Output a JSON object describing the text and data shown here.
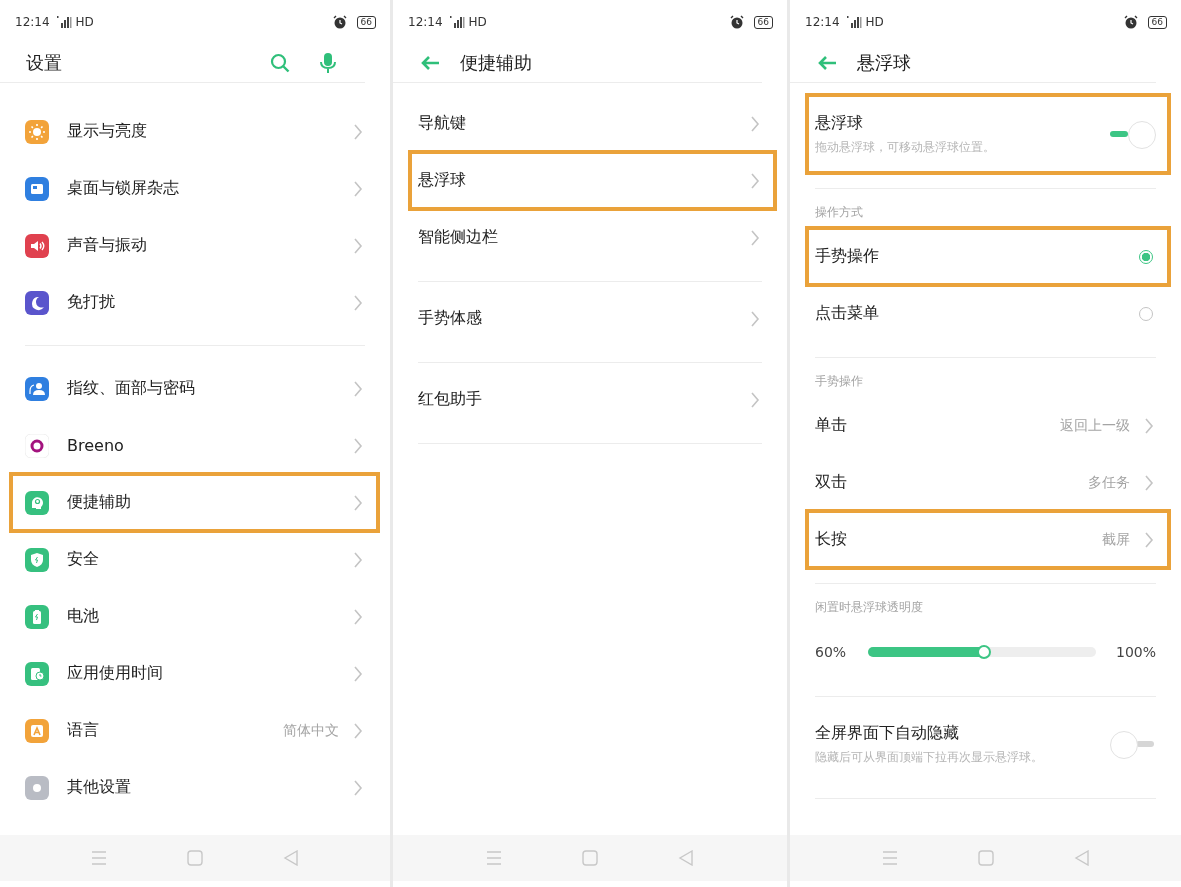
{
  "screens": [
    {
      "status_bar": {
        "time": "12:14",
        "network": "HD",
        "battery": "66"
      },
      "header": {
        "kind": "main",
        "title": "设置"
      },
      "sections": [
        {
          "items": [
            {
              "kind": "link",
              "label": "显示与亮度",
              "color": "#f2a33a",
              "highlighted": false
            },
            {
              "kind": "link",
              "label": "桌面与锁屏杂志",
              "color": "#2f7fe0",
              "highlighted": false
            },
            {
              "kind": "link",
              "label": "声音与振动",
              "color": "#e0414f",
              "highlighted": false
            },
            {
              "kind": "link",
              "label": "免打扰",
              "color": "#5a55cc",
              "highlighted": false
            }
          ]
        },
        {
          "items": [
            {
              "kind": "link",
              "label": "指纹、面部与密码",
              "color": "#2f7fe0",
              "highlighted": false
            },
            {
              "kind": "link",
              "label": "Breeno",
              "color": "#a3137e",
              "highlighted": false
            },
            {
              "kind": "link",
              "label": "便捷辅助",
              "color": "#36c07f",
              "highlighted": true
            },
            {
              "kind": "link",
              "label": "安全",
              "color": "#36c07f",
              "highlighted": false
            },
            {
              "kind": "link",
              "label": "电池",
              "color": "#36c07f",
              "highlighted": false
            },
            {
              "kind": "link",
              "label": "应用使用时间",
              "color": "#36c07f",
              "highlighted": false
            },
            {
              "kind": "link",
              "label": "语言",
              "value": "简体中文",
              "color": "#f2a33a",
              "highlighted": false
            },
            {
              "kind": "link",
              "label": "其他设置",
              "color": "#b9bcc4",
              "highlighted": false
            }
          ]
        }
      ]
    },
    {
      "status_bar": {
        "time": "12:14",
        "network": "HD",
        "battery": "66"
      },
      "header": {
        "kind": "sub",
        "title": "便捷辅助"
      },
      "sections": [
        {
          "items": [
            {
              "kind": "link",
              "label": "导航键",
              "highlighted": false
            },
            {
              "kind": "link",
              "label": "悬浮球",
              "highlighted": true
            },
            {
              "kind": "link",
              "label": "智能侧边栏",
              "highlighted": false
            }
          ]
        },
        {
          "items": [
            {
              "kind": "link",
              "label": "手势体感",
              "highlighted": false
            }
          ]
        },
        {
          "items": [
            {
              "kind": "link",
              "label": "红包助手",
              "highlighted": false
            }
          ]
        }
      ]
    },
    {
      "status_bar": {
        "time": "12:14",
        "network": "HD",
        "battery": "66"
      },
      "header": {
        "kind": "sub",
        "title": "悬浮球"
      },
      "sections": [
        {
          "items": [
            {
              "kind": "toggle",
              "label": "悬浮球",
              "description": "拖动悬浮球，可移动悬浮球位置。",
              "on": true,
              "highlighted": true
            }
          ]
        },
        {
          "title": "操作方式",
          "items": [
            {
              "kind": "radio",
              "label": "手势操作",
              "selected": true,
              "highlighted": true
            },
            {
              "kind": "radio",
              "label": "点击菜单",
              "selected": false,
              "highlighted": false
            }
          ]
        },
        {
          "title": "手势操作",
          "items": [
            {
              "kind": "link",
              "label": "单击",
              "value": "返回上一级",
              "highlighted": false
            },
            {
              "kind": "link",
              "label": "双击",
              "value": "多任务",
              "highlighted": false
            },
            {
              "kind": "link",
              "label": "长按",
              "value": "截屏",
              "highlighted": true
            }
          ]
        },
        {
          "title": "闲置时悬浮球透明度",
          "items": [
            {
              "kind": "slider",
              "min_label": "60%",
              "max_label": "100%",
              "level": 0.51
            }
          ]
        },
        {
          "items": [
            {
              "kind": "toggle",
              "label": "全屏界面下自动隐藏",
              "description": "隐藏后可从界面顶端下拉再次显示悬浮球。",
              "on": false,
              "highlighted": false
            }
          ]
        }
      ]
    }
  ]
}
